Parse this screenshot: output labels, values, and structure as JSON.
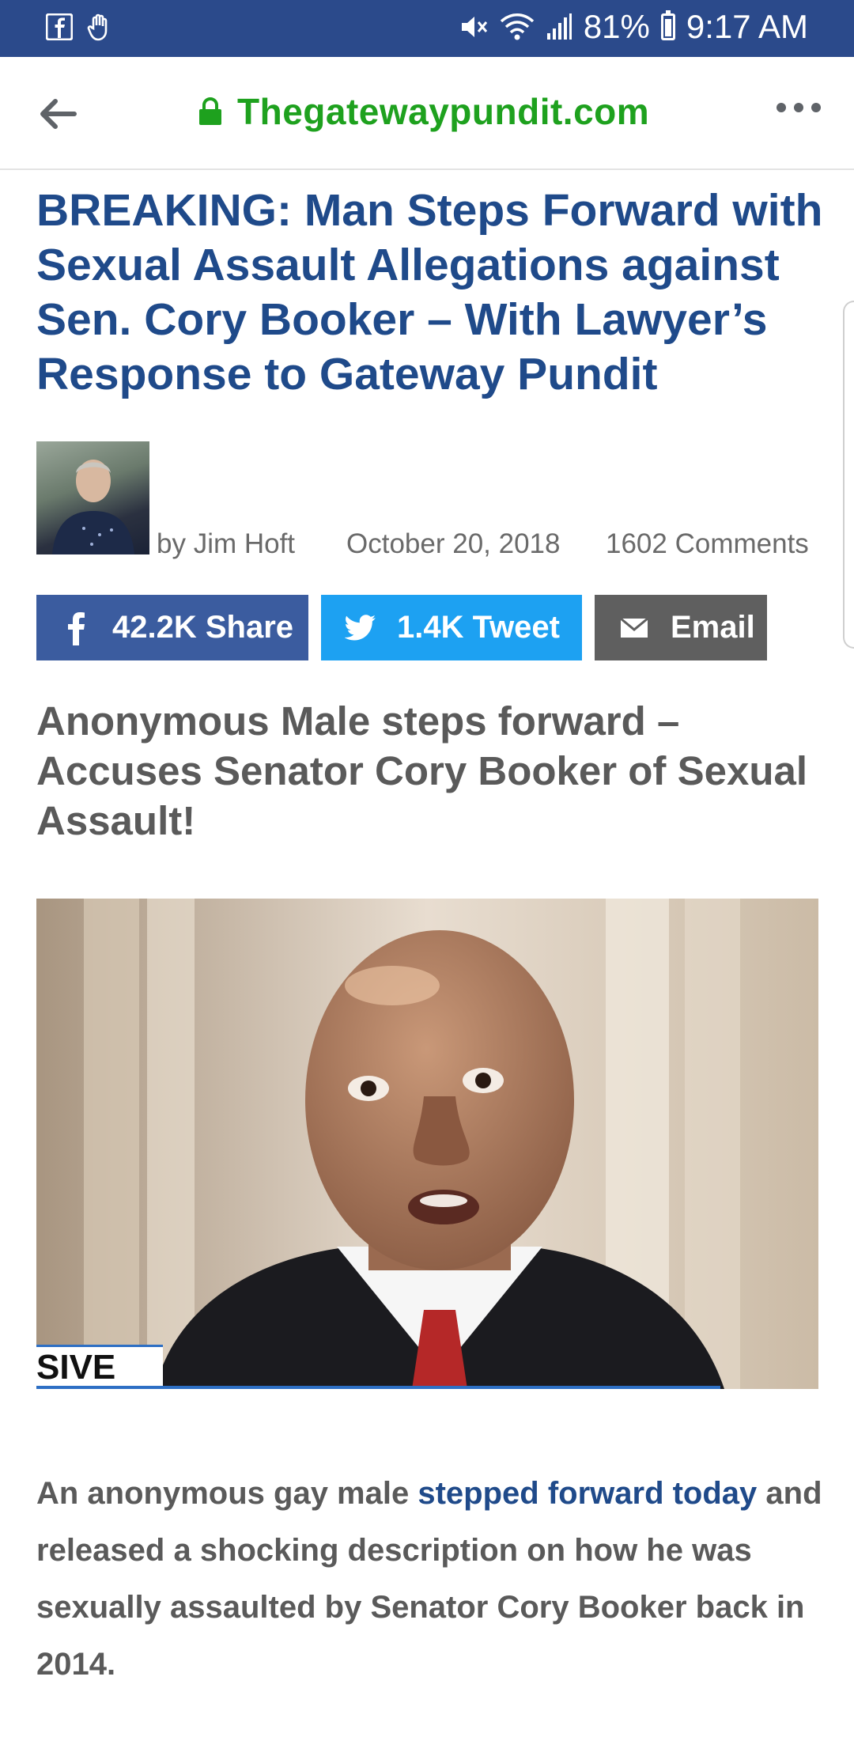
{
  "status_bar": {
    "battery_percent": "81%",
    "time": "9:17 AM",
    "icons": [
      "facebook-icon",
      "hand-icon",
      "mute-icon",
      "wifi-icon",
      "signal-icon",
      "battery-icon"
    ]
  },
  "toolbar": {
    "url": "Thegatewaypundit.com",
    "secure": true
  },
  "article": {
    "headline": "BREAKING: Man Steps Forward with Sexual Assault Allegations against Sen. Cory Booker – With Lawyer’s Response to Gateway Pundit",
    "author": "by Jim Hoft",
    "date": "October 20, 2018",
    "comments": "1602 Comments",
    "share": {
      "facebook_label": "42.2K Share",
      "twitter_label": "1.4K Tweet",
      "email_label": "Email"
    },
    "subhead": "Anonymous Male steps forward – Accuses Senator Cory Booker of Sexual Assault!",
    "photo_caption": "SIVE",
    "body_pre": "An anonymous gay male ",
    "body_link": "stepped forward today",
    "body_post": " and released a shocking description on how he was sexually assaulted by Senator Cory Booker back in 2014."
  },
  "colors": {
    "status_bar": "#2b4a8b",
    "url_green": "#1ea11e",
    "headline_blue": "#1f4a8a",
    "facebook": "#3b5c9f",
    "twitter": "#1da1f2",
    "email": "#5f5f5f"
  }
}
